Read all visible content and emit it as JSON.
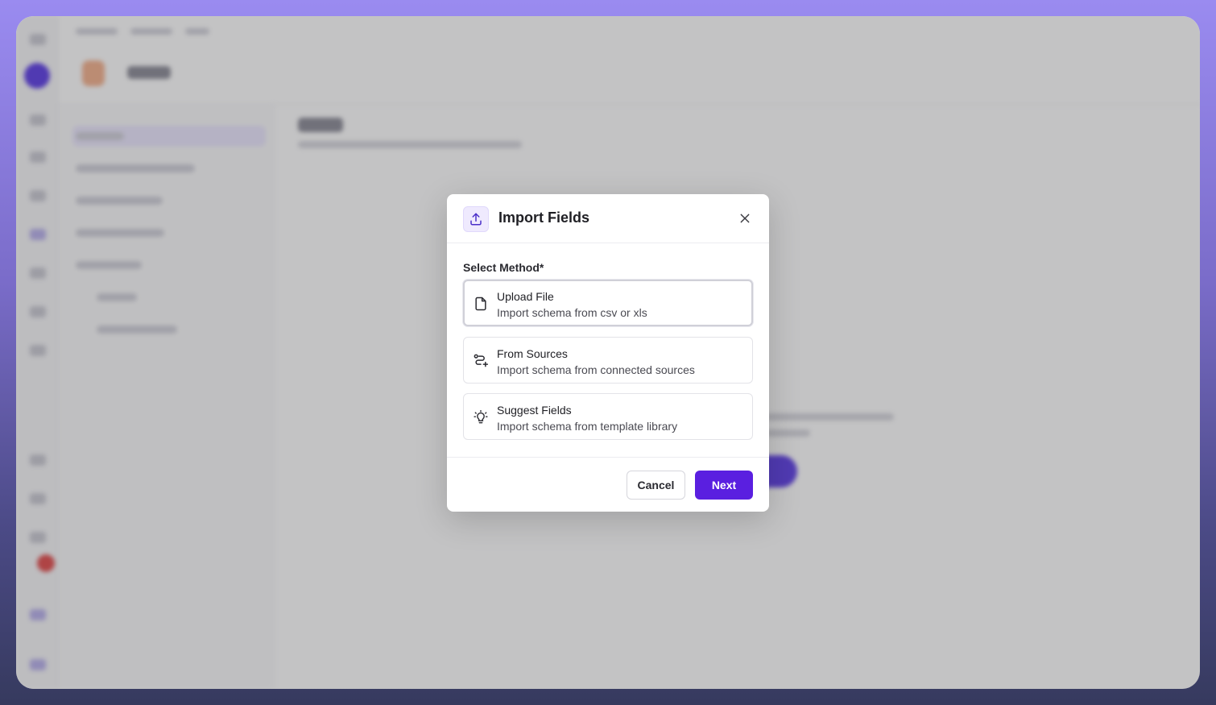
{
  "modal": {
    "title": "Import Fields",
    "header_icon": "upload-icon",
    "close_icon": "close-icon",
    "field_label": "Select Method*",
    "options": [
      {
        "title": "Upload File",
        "description": "Import schema from csv or xls",
        "icon": "file-icon",
        "selected": true
      },
      {
        "title": "From Sources",
        "description": "Import schema from connected sources",
        "icon": "route-plus-icon",
        "selected": false
      },
      {
        "title": "Suggest Fields",
        "description": "Import schema from template library",
        "icon": "lightbulb-icon",
        "selected": false
      }
    ],
    "cancel_label": "Cancel",
    "next_label": "Next"
  },
  "colors": {
    "primary": "#5a1fe0",
    "icon_bg": "#efeafe",
    "backdrop_gradient_top": "#9a8bf0",
    "backdrop_gradient_bottom": "#363a5e"
  }
}
